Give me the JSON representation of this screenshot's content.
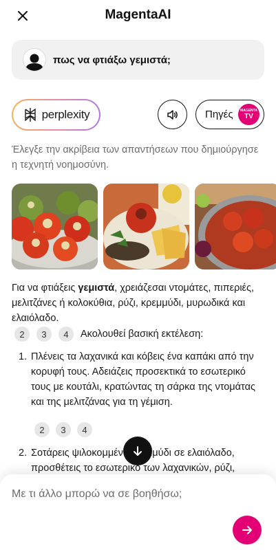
{
  "header": {
    "title": "MagentaAI",
    "close_icon": "close-icon"
  },
  "query": {
    "text": "πως να φτιάξω γεμιστά;",
    "avatar_icon": "user-avatar-icon"
  },
  "sources_bar": {
    "perplexity_label": "perplexity",
    "speaker_icon": "speaker-icon",
    "sources_label": "Πηγές",
    "badge_top": "MAGENTA",
    "badge_bottom": "TV"
  },
  "disclaimer": "Έλεγξε την ακρίβεια των απαντήσεων που δημιούργησε η τεχνητή νοημοσύνη.",
  "images": [
    {
      "name": "stuffed-tomatoes-pot-image"
    },
    {
      "name": "stuffed-tomato-plate-image"
    },
    {
      "name": "stuffed-vegetables-tray-image"
    }
  ],
  "answer": {
    "intro_before": "Για να φτιάξεις ",
    "intro_bold": "γεμιστά",
    "intro_after": ", χρειάζεσαι ντομάτες, πιπεριές, μελιτζάνες ή κολοκύθια, ρύζι, κρεμμύδι, μυρωδικά και ελαιόλαδο.",
    "citations_1": [
      "2",
      "3",
      "4"
    ],
    "follow_text": "Ακολουθεί βασική εκτέλεση:",
    "steps": [
      {
        "number": "1.",
        "text": "Πλένεις τα λαχανικά και κόβεις ένα καπάκι από την κορυφή τους. Αδειάζεις προσεκτικά το εσωτερικό τους με κουτάλι, κρατώντας τη σάρκα της ντομάτας και της μελιτζάνας για τη γέμιση."
      },
      {
        "number": "2.",
        "text": "Σοτάρεις ψιλοκομμένο κρεμμύδι σε ελαιόλαδο, προσθέτεις το εσωτερικό των λαχανικών, ρύζι,"
      }
    ],
    "citations_2": [
      "2",
      "3",
      "4"
    ]
  },
  "composer": {
    "placeholder": "Με τι άλλο μπορώ να σε βοηθήσω;",
    "send_icon": "arrow-right-icon"
  },
  "colors": {
    "brand": "#e20074",
    "query_bg": "#f1f1f1",
    "citation_bg": "#e6e6e6",
    "muted_text": "#6b6b6b"
  }
}
